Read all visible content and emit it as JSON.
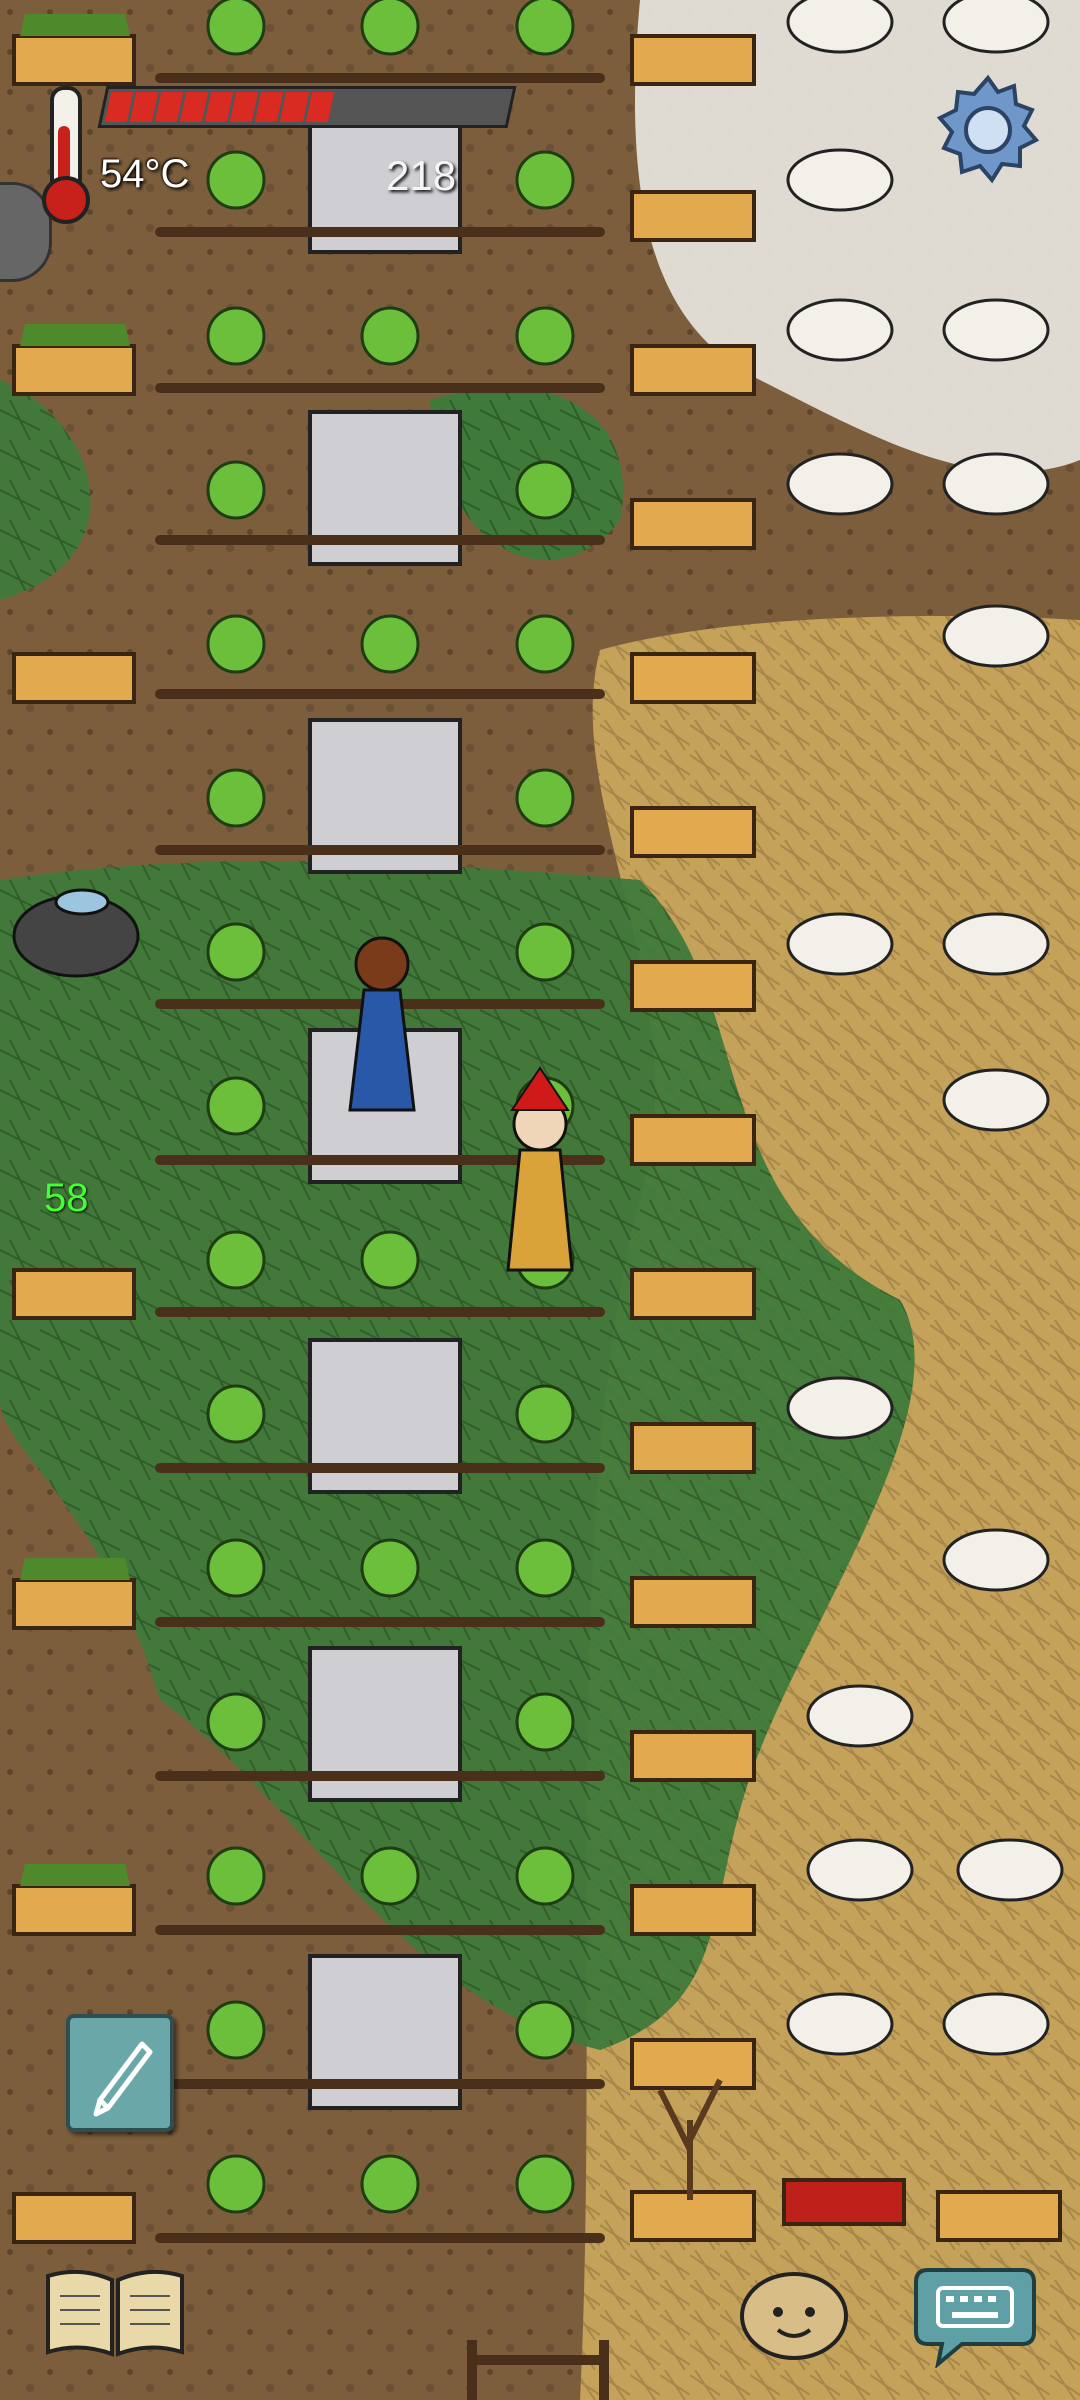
{
  "hud": {
    "temperature": "54°C",
    "counter": "218",
    "age": "58",
    "food_pips_total": 16,
    "food_pips_full": 9
  },
  "icons": {
    "thermometer": "thermometer-icon",
    "settings": "gear-icon",
    "journal": "book-icon",
    "note": "pencil-icon",
    "emote": "potato-face-icon",
    "chat": "keyboard-icon"
  },
  "colors": {
    "grass": "#3f7a3a",
    "dry_grass": "#c4a25a",
    "dirt": "#7d5e3c",
    "snow": "#e8e6e0",
    "hunger_red": "#d92b22",
    "age_green": "#44ff33"
  }
}
